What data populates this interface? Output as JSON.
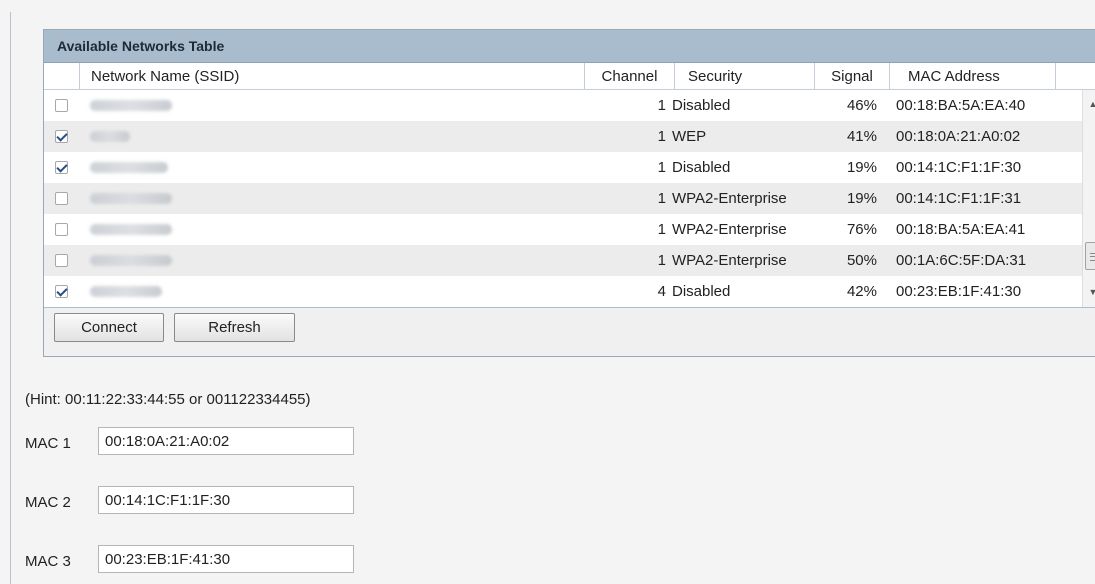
{
  "networks_table": {
    "title": "Available Networks Table",
    "columns": {
      "ssid": "Network Name (SSID)",
      "channel": "Channel",
      "security": "Security",
      "signal": "Signal",
      "mac": "MAC Address"
    },
    "rows": [
      {
        "checked": false,
        "channel": "1",
        "security": "Disabled",
        "signal": "46%",
        "mac": "00:18:BA:5A:EA:40"
      },
      {
        "checked": true,
        "channel": "1",
        "security": "WEP",
        "signal": "41%",
        "mac": "00:18:0A:21:A0:02"
      },
      {
        "checked": true,
        "channel": "1",
        "security": "Disabled",
        "signal": "19%",
        "mac": "00:14:1C:F1:1F:30"
      },
      {
        "checked": false,
        "channel": "1",
        "security": "WPA2-Enterprise",
        "signal": "19%",
        "mac": "00:14:1C:F1:1F:31"
      },
      {
        "checked": false,
        "channel": "1",
        "security": "WPA2-Enterprise",
        "signal": "76%",
        "mac": "00:18:BA:5A:EA:41"
      },
      {
        "checked": false,
        "channel": "1",
        "security": "WPA2-Enterprise",
        "signal": "50%",
        "mac": "00:1A:6C:5F:DA:31"
      },
      {
        "checked": true,
        "channel": "4",
        "security": "Disabled",
        "signal": "42%",
        "mac": "00:23:EB:1F:41:30"
      }
    ],
    "buttons": {
      "connect": "Connect",
      "refresh": "Refresh"
    },
    "icons": {
      "scroll_up": "scroll-up-arrow-icon",
      "scroll_down": "scroll-down-arrow-icon"
    }
  },
  "mac_form": {
    "hint": "(Hint: 00:11:22:33:44:55 or 001122334455)",
    "fields": [
      {
        "label": "MAC 1",
        "value": "00:18:0A:21:A0:02"
      },
      {
        "label": "MAC 2",
        "value": "00:14:1C:F1:1F:30"
      },
      {
        "label": "MAC 3",
        "value": "00:23:EB:1F:41:30"
      }
    ]
  }
}
